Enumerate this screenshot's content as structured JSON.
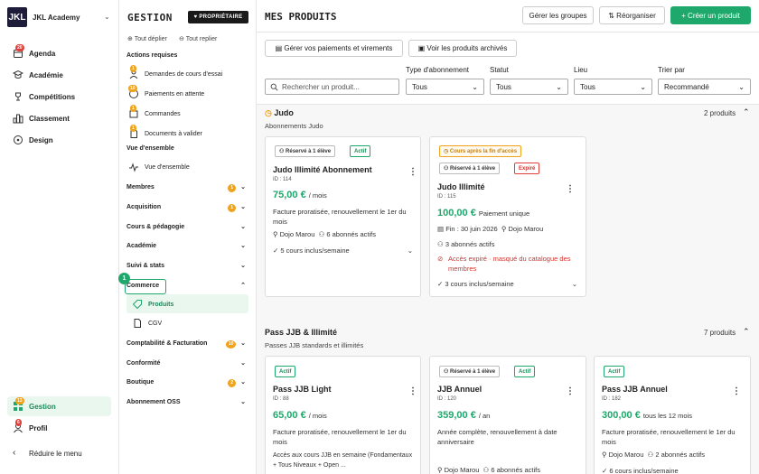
{
  "brand": {
    "logo": "JKL",
    "name": "JKL Academy"
  },
  "nav": {
    "items": [
      {
        "label": "Agenda",
        "badge": "20"
      },
      {
        "label": "Académie"
      },
      {
        "label": "Compétitions"
      },
      {
        "label": "Classement"
      },
      {
        "label": "Design"
      }
    ],
    "gestion": {
      "label": "Gestion",
      "badge": "13"
    },
    "profil": {
      "label": "Profil",
      "badge": "6"
    },
    "reduce": "Réduire le menu"
  },
  "gestion": {
    "title": "GESTION",
    "owner": "PROPRIÉTAIRE",
    "expand_all": "Tout déplier",
    "collapse_all": "Tout replier",
    "actions_title": "Actions requises",
    "actions": [
      {
        "label": "Demandes de cours d'essai",
        "badge": "1"
      },
      {
        "label": "Paiements en attente",
        "badge": "10"
      },
      {
        "label": "Commandes",
        "badge": "1"
      },
      {
        "label": "Documents à valider",
        "badge": "1"
      }
    ],
    "overview_title": "Vue d'ensemble",
    "overview_item": "Vue d'ensemble",
    "groups": [
      {
        "label": "Membres",
        "badge": "1"
      },
      {
        "label": "Acquisition",
        "badge": "1"
      },
      {
        "label": "Cours & pédagogie"
      },
      {
        "label": "Académie"
      },
      {
        "label": "Suivi & stats"
      },
      {
        "label": "Commerce"
      }
    ],
    "commerce_items": [
      "Produits",
      "CGV"
    ],
    "groups2": [
      {
        "label": "Comptabilité & Facturation",
        "badge": "10"
      },
      {
        "label": "Conformité"
      },
      {
        "label": "Boutique",
        "badge": "2"
      },
      {
        "label": "Abonnement OSS"
      }
    ],
    "step": "1"
  },
  "main": {
    "title": "MES PRODUITS",
    "manage_groups": "Gérer les groupes",
    "reorder": "Réorganiser",
    "create": "+ Créer un produit",
    "manage_payments": "Gérer vos paiements et virements",
    "archived": "Voir les produits archivés",
    "search_placeholder": "Rechercher un produit...",
    "filters": [
      {
        "label": "Type d'abonnement",
        "value": "Tous"
      },
      {
        "label": "Statut",
        "value": "Tous"
      },
      {
        "label": "Lieu",
        "value": "Tous"
      },
      {
        "label": "Trier par",
        "value": "Recommandé"
      }
    ]
  },
  "sections": [
    {
      "title": "Judo",
      "subtitle": "Abonnements Judo",
      "count": "2 produits",
      "cards": [
        {
          "pills": [
            "Réservé à 1 élève",
            "Actif"
          ],
          "name": "Judo Illimité Abonnement",
          "id": "ID : 114",
          "price": "75,00 €",
          "period": "/ mois",
          "desc": "Facture proratisée, renouvellement le 1er du mois",
          "location": "Dojo Marou",
          "subscribers": "6 abonnés actifs",
          "courses": "5 cours inclus/semaine"
        },
        {
          "pill_top": "Cours après la fin d'accès",
          "pills": [
            "Réservé à 1 élève",
            "Expiré"
          ],
          "name": "Judo Illimité",
          "id": "ID : 115",
          "price": "100,00 €",
          "period": "Paiement unique",
          "end": "Fin : 30 juin 2026",
          "location": "Dojo Marou",
          "subscribers": "3 abonnés actifs",
          "warning": "Accès expiré · masqué du catalogue des membres",
          "courses": "3 cours inclus/semaine"
        }
      ]
    },
    {
      "title": "Pass JJB & Illimité",
      "subtitle": "Passes JJB standards et illimités",
      "count": "7 produits",
      "cards": [
        {
          "pills": [
            "Actif"
          ],
          "name": "Pass JJB Light",
          "id": "ID : 88",
          "price": "65,00 €",
          "period": "/ mois",
          "desc": "Facture proratisée, renouvellement le 1er du mois",
          "extra": "Accès aux cours JJB en semaine (Fondamentaux + Tous Niveaux + Open ..."
        },
        {
          "pills": [
            "Réservé à 1 élève",
            "Actif"
          ],
          "name": "JJB Annuel",
          "id": "ID : 120",
          "price": "359,00 €",
          "period": "/ an",
          "desc": "Année complète, renouvellement à date anniversaire",
          "location": "Dojo Marou",
          "subscribers": "6 abonnés actifs"
        },
        {
          "pills": [
            "Actif"
          ],
          "name": "Pass JJB Annuel",
          "id": "ID : 182",
          "price": "300,00 €",
          "period": "tous les 12 mois",
          "desc": "Facture proratisée, renouvellement le 1er du mois",
          "location": "Dojo Marou",
          "subscribers": "2 abonnés actifs",
          "courses": "6 cours inclus/semaine"
        }
      ]
    }
  ],
  "colors": {
    "accent": "#1fa86b",
    "danger": "#e0403a",
    "warning": "#f0a31c"
  }
}
